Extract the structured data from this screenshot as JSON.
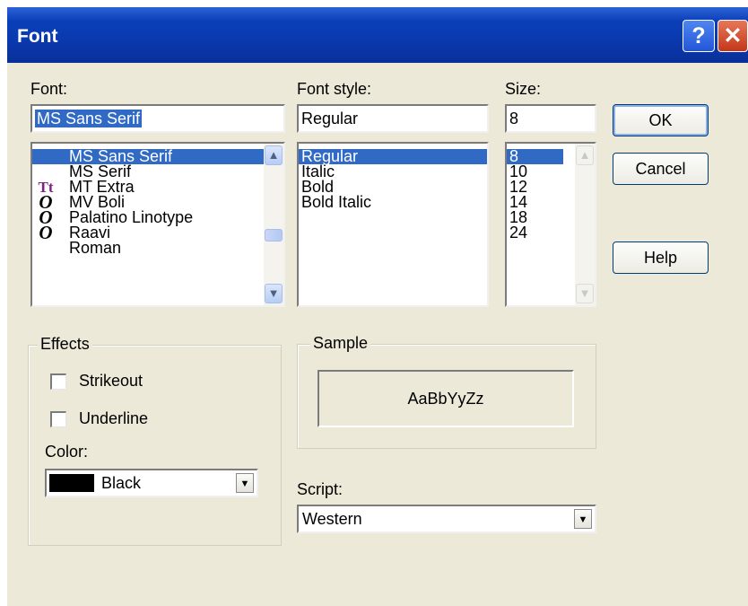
{
  "window": {
    "title": "Font",
    "help_glyph": "?",
    "close_glyph": "✕"
  },
  "font": {
    "label": "Font:",
    "value": "MS Sans Serif",
    "items": [
      {
        "name": "MS Sans Serif",
        "icon": "",
        "icon_name": "none"
      },
      {
        "name": "MS Serif",
        "icon": "",
        "icon_name": "none"
      },
      {
        "name": "MT Extra",
        "icon": "Tt",
        "icon_name": "truetype-font-icon"
      },
      {
        "name": "MV Boli",
        "icon": "O",
        "icon_name": "opentype-font-icon"
      },
      {
        "name": "Palatino Linotype",
        "icon": "O",
        "icon_name": "opentype-font-icon"
      },
      {
        "name": "Raavi",
        "icon": "O",
        "icon_name": "opentype-font-icon"
      },
      {
        "name": "Roman",
        "icon": "",
        "icon_name": "none"
      }
    ]
  },
  "style": {
    "label": "Font style:",
    "value": "Regular",
    "items": [
      "Regular",
      "Italic",
      "Bold",
      "Bold Italic"
    ]
  },
  "size": {
    "label": "Size:",
    "value": "8",
    "items": [
      "8",
      "10",
      "12",
      "14",
      "18",
      "24"
    ]
  },
  "buttons": {
    "ok": "OK",
    "cancel": "Cancel",
    "help": "Help"
  },
  "effects": {
    "label": "Effects",
    "strikeout": {
      "label": "Strikeout",
      "checked": false
    },
    "underline": {
      "label": "Underline",
      "checked": false
    },
    "color_label": "Color:",
    "color_value": "Black",
    "color_hex": "#000000"
  },
  "sample": {
    "label": "Sample",
    "text": "AaBbYyZz"
  },
  "script": {
    "label": "Script:",
    "value": "Western"
  },
  "icons": {
    "scroll_up": "▲",
    "scroll_down": "▼",
    "dropdown": "▼"
  },
  "colors": {
    "title_bar": "#0a3ab0",
    "dialog_bg": "#ece9d8",
    "selection": "#316ac5"
  }
}
